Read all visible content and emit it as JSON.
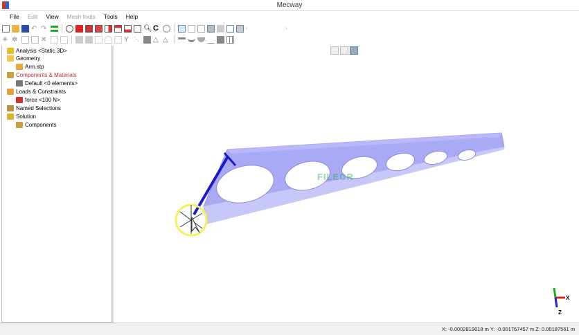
{
  "window": {
    "title": "Mecway"
  },
  "menu": [
    "File",
    "Edit",
    "View",
    "Mesh tools",
    "Tools",
    "Help"
  ],
  "menu_disabled": [
    false,
    true,
    false,
    true,
    false,
    false
  ],
  "tree": [
    {
      "label": "Analysis <Static 3D>",
      "icon": "analysis-icon",
      "depth": 0,
      "color": "#000"
    },
    {
      "label": "Geometry",
      "icon": "folder-icon",
      "depth": 0,
      "color": "#000"
    },
    {
      "label": "Arm.stp",
      "icon": "geometry-file-icon",
      "depth": 1,
      "color": "#000"
    },
    {
      "label": "Components & Materials",
      "icon": "components-icon",
      "depth": 0,
      "color": "#c0283a"
    },
    {
      "label": "Default <0 elements>",
      "icon": "component-icon",
      "depth": 1,
      "color": "#000"
    },
    {
      "label": "Loads & Constraints",
      "icon": "loads-icon",
      "depth": 0,
      "color": "#000"
    },
    {
      "label": "force <100 N>",
      "icon": "force-icon",
      "depth": 1,
      "color": "#000"
    },
    {
      "label": "Named Selections",
      "icon": "named-selections-icon",
      "depth": 0,
      "color": "#000"
    },
    {
      "label": "Solution",
      "icon": "solution-icon",
      "depth": 0,
      "color": "#000"
    },
    {
      "label": "Components",
      "icon": "components-icon",
      "depth": 1,
      "color": "#000"
    }
  ],
  "axes": {
    "x": "X",
    "z": "Z"
  },
  "status": {
    "coords": "X: -0.0002819618 m Y: -0.001767457 m Z: 0.00187561 m"
  },
  "watermark": "FILECR",
  "colors": {
    "beam": "#a9a9f5",
    "force": "#1a1acc",
    "cursor_ring": "#f5f060"
  }
}
